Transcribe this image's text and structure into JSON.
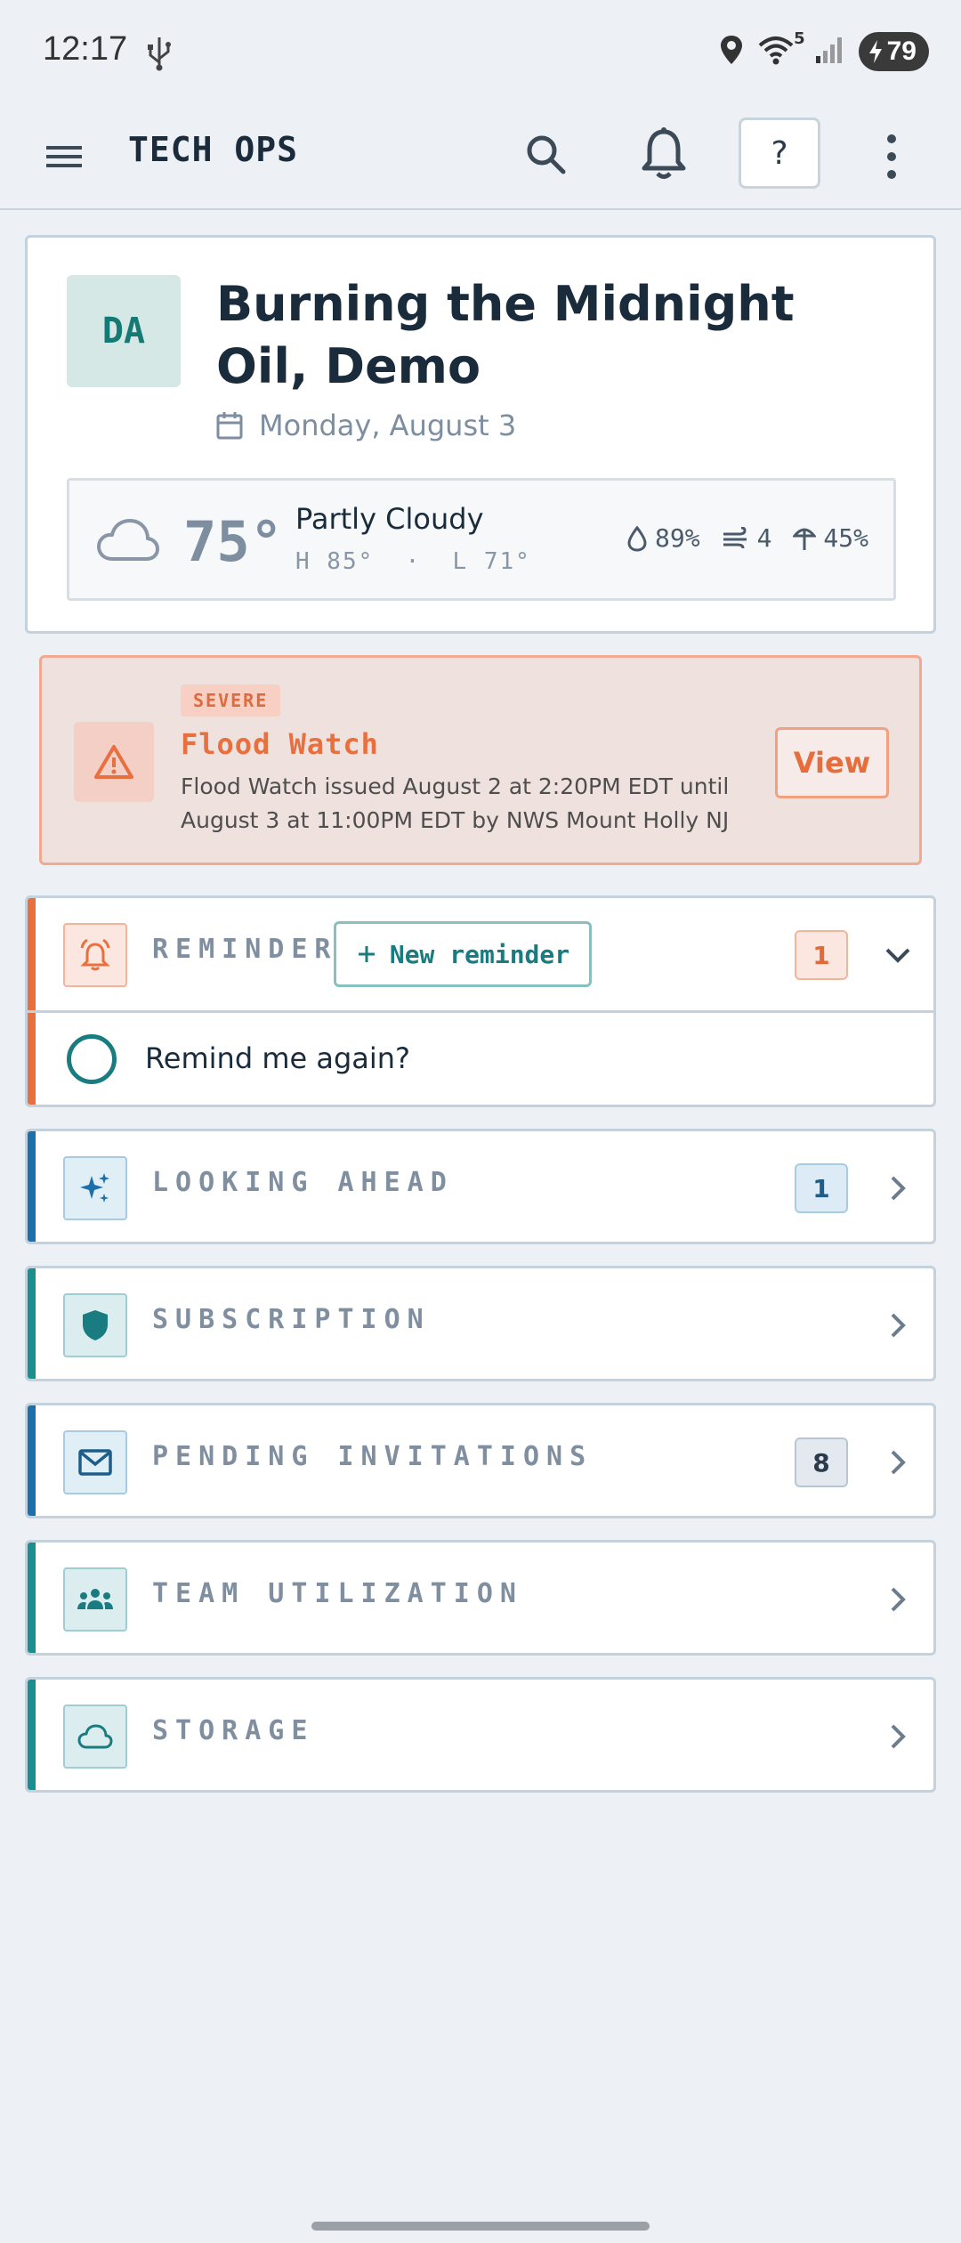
{
  "status_bar": {
    "time": "12:17",
    "wifi_badge": "5",
    "battery": "79"
  },
  "app_bar": {
    "title": "TECH OPS",
    "help_label": "?"
  },
  "header": {
    "avatar_initials": "DA",
    "title": "Burning the Midnight Oil, Demo",
    "date": "Monday, August 3",
    "weather": {
      "temperature": "75°",
      "condition": "Partly Cloudy",
      "high_low": "H 85°  ·  L 71°",
      "humidity": "89%",
      "wind": "4",
      "precip": "45%"
    }
  },
  "alert": {
    "severity": "SEVERE",
    "title": "Flood Watch",
    "body": "Flood Watch issued August 2 at 2:20PM EDT until August 3 at 11:00PM EDT by NWS Mount Holly NJ",
    "action": "View"
  },
  "reminders": {
    "label": "REMINDERS",
    "new_button": "New reminder",
    "count": "1",
    "items": [
      {
        "text": "Remind me again?"
      }
    ]
  },
  "sections": [
    {
      "label": "LOOKING AHEAD",
      "count": "1",
      "icon": "sparkle-icon",
      "bar_color": "#1c6fa8"
    },
    {
      "label": "SUBSCRIPTION",
      "icon": "shield-icon",
      "bar_color": "#1b8f8f"
    },
    {
      "label": "PENDING INVITATIONS",
      "count": "8",
      "icon": "mail-icon",
      "bar_color": "#1c6fa8"
    },
    {
      "label": "TEAM UTILIZATION",
      "icon": "team-icon",
      "bar_color": "#1b8f8f"
    },
    {
      "label": "STORAGE",
      "icon": "cloud-icon",
      "bar_color": "#1b8f8f"
    }
  ],
  "colors": {
    "accent_teal": "#187c80",
    "accent_orange": "#e8703f",
    "accent_blue": "#1c6fa8"
  }
}
